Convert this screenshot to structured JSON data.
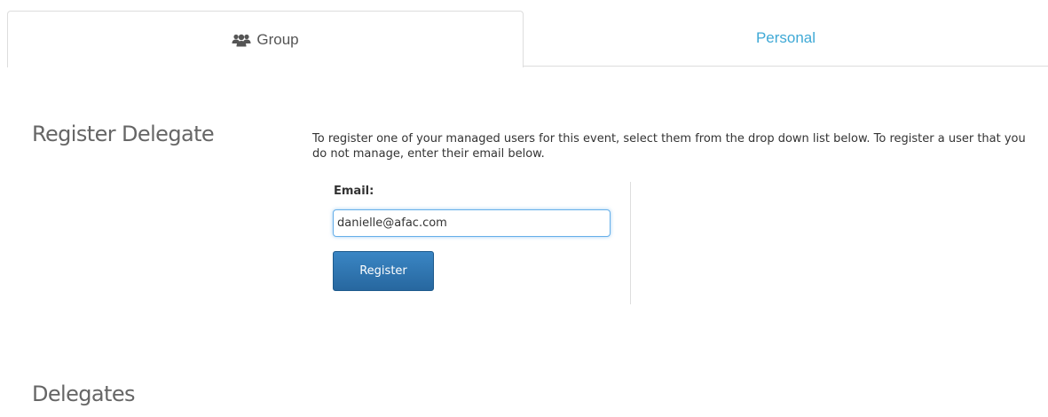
{
  "tabs": {
    "group_label": "Group",
    "group_icon": "users-icon",
    "personal_label": "Personal",
    "active": "Group"
  },
  "register_section": {
    "title": "Register Delegate",
    "instructions": "To register one of your managed users for this event, select them from the drop down list below. To register a user that you do not manage, enter their email below.",
    "email_label": "Email:",
    "email_value": "danielle@afac.com",
    "register_button_label": "Register"
  },
  "delegates_section": {
    "title": "Delegates"
  },
  "colors": {
    "tab_link": "#3fa9d6",
    "button": "#2f77b4",
    "focus_border": "#66afe9",
    "heading": "#666666"
  }
}
